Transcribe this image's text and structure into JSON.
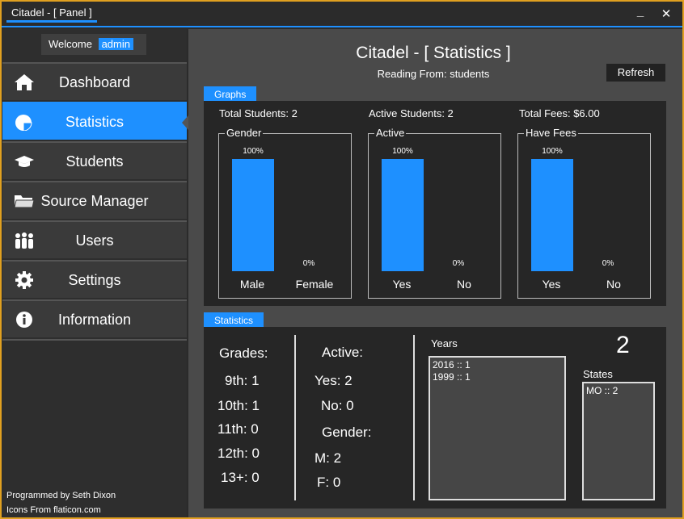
{
  "window": {
    "title": "Citadel - [ Panel ]",
    "minimize": "_",
    "close": "✕"
  },
  "sidebar": {
    "welcome": "Welcome",
    "user": "admin",
    "items": [
      {
        "label": "Dashboard",
        "icon": "home-icon"
      },
      {
        "label": "Statistics",
        "icon": "pie-chart-icon"
      },
      {
        "label": "Students",
        "icon": "graduation-cap-icon"
      },
      {
        "label": "Source Manager",
        "icon": "folder-icon"
      },
      {
        "label": "Users",
        "icon": "users-icon"
      },
      {
        "label": "Settings",
        "icon": "gear-icon"
      },
      {
        "label": "Information",
        "icon": "info-icon"
      }
    ],
    "credit1": "Programmed by Seth Dixon",
    "credit2": "Icons From flaticon.com"
  },
  "main": {
    "title": "Citadel - [ Statistics ]",
    "reading": "Reading From: students",
    "refresh": "Refresh"
  },
  "graphs": {
    "tab": "Graphs",
    "total_students": "Total Students: 2",
    "active_students": "Active Students: 2",
    "total_fees": "Total Fees: $6.00"
  },
  "chart_data": [
    {
      "type": "bar",
      "title": "Gender",
      "categories": [
        "Male",
        "Female"
      ],
      "values": [
        100,
        0
      ],
      "labels": [
        "100%",
        "0%"
      ],
      "ylim": [
        0,
        100
      ]
    },
    {
      "type": "bar",
      "title": "Active",
      "categories": [
        "Yes",
        "No"
      ],
      "values": [
        100,
        0
      ],
      "labels": [
        "100%",
        "0%"
      ],
      "ylim": [
        0,
        100
      ]
    },
    {
      "type": "bar",
      "title": "Have Fees",
      "categories": [
        "Yes",
        "No"
      ],
      "values": [
        100,
        0
      ],
      "labels": [
        "100%",
        "0%"
      ],
      "ylim": [
        0,
        100
      ]
    }
  ],
  "statistics": {
    "tab": "Statistics",
    "grades_heading": "Grades:",
    "grades": [
      "9th: 1",
      "10th: 1",
      "11th: 0",
      "12th: 0",
      "13+: 0"
    ],
    "active_heading": "Active:",
    "active_yes": "Yes: 2",
    "active_no": "No: 0",
    "gender_heading": "Gender:",
    "gender_m": "M: 2",
    "gender_f": "F: 0",
    "years_label": "Years",
    "years": [
      "2016 :: 1",
      "1999 :: 1"
    ],
    "count": "2",
    "states_label": "States",
    "states": [
      "MO :: 2"
    ]
  },
  "colors": {
    "accent": "#1e90ff",
    "border": "#e0a020"
  }
}
